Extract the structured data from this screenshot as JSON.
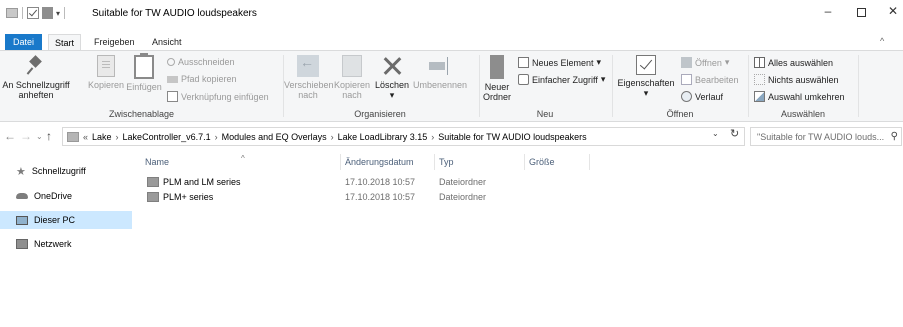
{
  "window": {
    "title": "Suitable for TW AUDIO loudspeakers",
    "minimize": "–",
    "close": "✕"
  },
  "tabs": {
    "datei": "Datei",
    "start": "Start",
    "freigeben": "Freigeben",
    "ansicht": "Ansicht",
    "collapse": "^"
  },
  "ribbon": {
    "clipboard": {
      "pin_line1": "An Schnellzugriff",
      "pin_line2": "anheften",
      "copy": "Kopieren",
      "paste": "Einfügen",
      "cut": "Ausschneiden",
      "copy_path": "Pfad kopieren",
      "paste_shortcut": "Verknüpfung einfügen",
      "label": "Zwischenablage"
    },
    "organize": {
      "move_line1": "Verschieben",
      "move_line2": "nach",
      "copyto_line1": "Kopieren",
      "copyto_line2": "nach",
      "delete": "Löschen",
      "rename": "Umbenennen",
      "label": "Organisieren"
    },
    "new": {
      "folder_line1": "Neuer",
      "folder_line2": "Ordner",
      "new_item": "Neues Element",
      "easy_access": "Einfacher Zugriff",
      "label": "Neu"
    },
    "open": {
      "properties": "Eigenschaften",
      "open": "Öffnen",
      "edit": "Bearbeiten",
      "history": "Verlauf",
      "label": "Öffnen"
    },
    "select": {
      "select_all": "Alles auswählen",
      "select_none": "Nichts auswählen",
      "invert": "Auswahl umkehren",
      "label": "Auswählen"
    }
  },
  "address": {
    "overflow": "«",
    "crumbs": [
      "Lake",
      "LakeController_v6.7.1",
      "Modules and EQ Overlays",
      "Lake LoadLibrary 3.15",
      "Suitable for TW AUDIO loudspeakers"
    ],
    "separator": "›"
  },
  "search": {
    "placeholder": "\"Suitable for TW AUDIO louds..."
  },
  "navpane": {
    "items": [
      "Schnellzugriff",
      "OneDrive",
      "Dieser PC",
      "Netzwerk"
    ]
  },
  "columns": {
    "name": "Name",
    "date": "Änderungsdatum",
    "type": "Typ",
    "size": "Größe"
  },
  "files": [
    {
      "name": "PLM and LM series",
      "date": "17.10.2018 10:57",
      "type": "Dateiordner"
    },
    {
      "name": "PLM+ series",
      "date": "17.10.2018 10:57",
      "type": "Dateiordner"
    }
  ]
}
